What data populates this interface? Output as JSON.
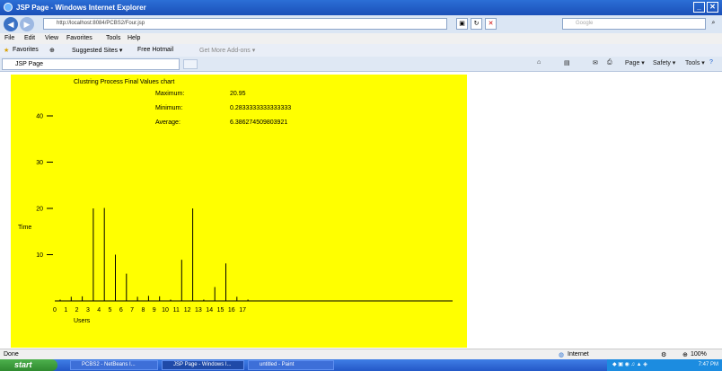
{
  "window": {
    "title": "JSP Page - Windows Internet Explorer"
  },
  "address": {
    "url": "http://localhost:8084/PCBS2/Four.jsp",
    "search_placeholder": "Google"
  },
  "menu": [
    "File",
    "Edit",
    "View",
    "Favorites",
    "Tools",
    "Help"
  ],
  "favorites": {
    "label": "Favorites",
    "items": [
      "Suggested Sites ▾",
      "Free Hotmail",
      "Get More Add-ons ▾"
    ]
  },
  "tab": {
    "label": "JSP Page"
  },
  "commandbar": {
    "page": "Page ▾",
    "safety": "Safety ▾",
    "tools": "Tools ▾"
  },
  "status": {
    "left": "Done",
    "zone": "Internet",
    "zoom": "100%"
  },
  "taskbar": {
    "start": "start",
    "tasks": [
      "PCBS2 - NetBeans I...",
      "JSP Page - Windows I...",
      "untitled - Paint"
    ],
    "clock": "7:47 PM"
  },
  "chart_data": {
    "type": "bar",
    "title": "Clustring Process Final Values chart",
    "stats": [
      {
        "label": "Maximum:",
        "value": "20.95"
      },
      {
        "label": "Minimum:",
        "value": "0.2833333333333333"
      },
      {
        "label": "Average:",
        "value": "6.386274509803921"
      }
    ],
    "xlabel": "Users",
    "ylabel": "Time",
    "categories": [
      "0",
      "1",
      "2",
      "3",
      "4",
      "5",
      "6",
      "7",
      "8",
      "9",
      "10",
      "11",
      "12",
      "13",
      "14",
      "15",
      "16",
      "17"
    ],
    "values": [
      0.3,
      0.9,
      1.0,
      20.0,
      20.1,
      10.0,
      5.9,
      0.9,
      1.1,
      1.0,
      0.3,
      8.9,
      20.0,
      0.3,
      3.0,
      8.1,
      0.9,
      0.3
    ],
    "yticks": [
      10,
      20,
      30,
      40
    ],
    "ylim": [
      0,
      49
    ]
  },
  "colors": {
    "chart_bg": "#ffff00",
    "titlebar": "#1b4fb8",
    "taskbar": "#2458c7"
  }
}
